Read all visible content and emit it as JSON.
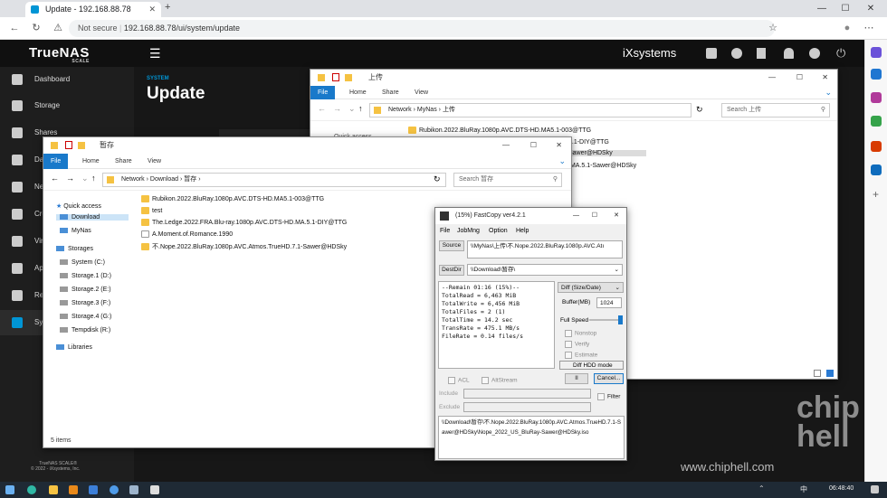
{
  "browser": {
    "tab_title": "Update - 192.168.88.78",
    "security": "Not secure",
    "url": "192.168.88.78/ui/system/update"
  },
  "truenas": {
    "logo": "TrueNAS",
    "logo_sub": "SCALE",
    "brand": "iXsystems",
    "section": "SYSTEM",
    "page_title": "Update",
    "nav": [
      "Dashboard",
      "Storage",
      "Shares",
      "Da",
      "Ne",
      "Cre",
      "Vir",
      "Ap",
      "Re",
      "Sys"
    ],
    "footer_1": "TrueNAS SCALE®",
    "footer_2": "© 2022 - iXsystems, Inc."
  },
  "explorer_back": {
    "title": "上传",
    "tabs": [
      "File",
      "Home",
      "Share",
      "View"
    ],
    "path": [
      "Network",
      "MyNas",
      "上传"
    ],
    "search": "Search 上传",
    "quick_access": "Quick access",
    "items": [
      "Rubikon.2022.BluRay.1080p.AVC.DTS-HD.MA5.1-003@TTG",
      "5.1-DIY@TTG",
      "Sawer@HDSky",
      ".MA.5.1-Sawer@HDSky"
    ]
  },
  "explorer_front": {
    "title": "暂存",
    "tabs": [
      "File",
      "Home",
      "Share",
      "View"
    ],
    "path": [
      "Network",
      "Download",
      "暂存"
    ],
    "search": "Search 暂存",
    "nav": [
      "Quick access",
      "Download",
      "MyNas",
      "Storages",
      "System (C:)",
      "Storage.1 (D:)",
      "Storage.2 (E:)",
      "Storage.3 (F:)",
      "Storage.4 (G:)",
      "Tempdisk (R:)",
      "Libraries"
    ],
    "items": [
      "Rubikon.2022.BluRay.1080p.AVC.DTS-HD.MA5.1-003@TTG",
      "test",
      "The.Ledge.2022.FRA.Blu-ray.1080p.AVC.DTS-HD.MA.5.1-DIY@TTG",
      "A.Moment.of.Romance.1990",
      "不.Nope.2022.BluRay.1080p.AVC.Atmos.TrueHD.7.1-Sawer@HDSky"
    ],
    "status": "5 items"
  },
  "fastcopy": {
    "title": "(15%) FastCopy ver4.2.1",
    "menu": [
      "File",
      "JobMng",
      "Option",
      "Help"
    ],
    "source_btn": "Source",
    "source": "\\\\MyNas\\上传\\不.Nope.2022.BluRay.1080p.AVC.Atı",
    "destdir_btn": "DestDir",
    "destdir": "\\\\Download\\暂存\\",
    "stats": [
      "--Remain 01:16 (15%)--",
      "TotalRead  = 6,463 MiB",
      "TotalWrite = 6,456 MiB",
      "TotalFiles = 2 (1)",
      "TotalTime  = 14.2 sec",
      "TransRate  = 475.1 MB/s",
      "FileRate   = 0.14 files/s"
    ],
    "mode": "Diff (Size/Date)",
    "buffer_label": "Buffer(MB)",
    "buffer": "1024",
    "speed": "Full Speed",
    "options": [
      "Nonstop",
      "Verify",
      "Estimate"
    ],
    "diff_hdd": "Diff HDD mode",
    "acl": "ACL",
    "altstream": "AltStream",
    "pause": "II",
    "cancel": "Cancel...",
    "include": "Include",
    "exclude": "Exclude",
    "filter": "Filter",
    "current_file": "\\\\Download\\暂存\\不.Nope.2022.BluRay.1080p.AVC.Atmos.TrueHD.7.1-Sawer@HDSky\\Nope_2022_US_BluRay-Sawer@HDSky.iso"
  },
  "taskbar": {
    "lang": "中",
    "time": "06:48:40"
  },
  "watermark": "www.chiphell.com",
  "chiphell": "chip hell"
}
